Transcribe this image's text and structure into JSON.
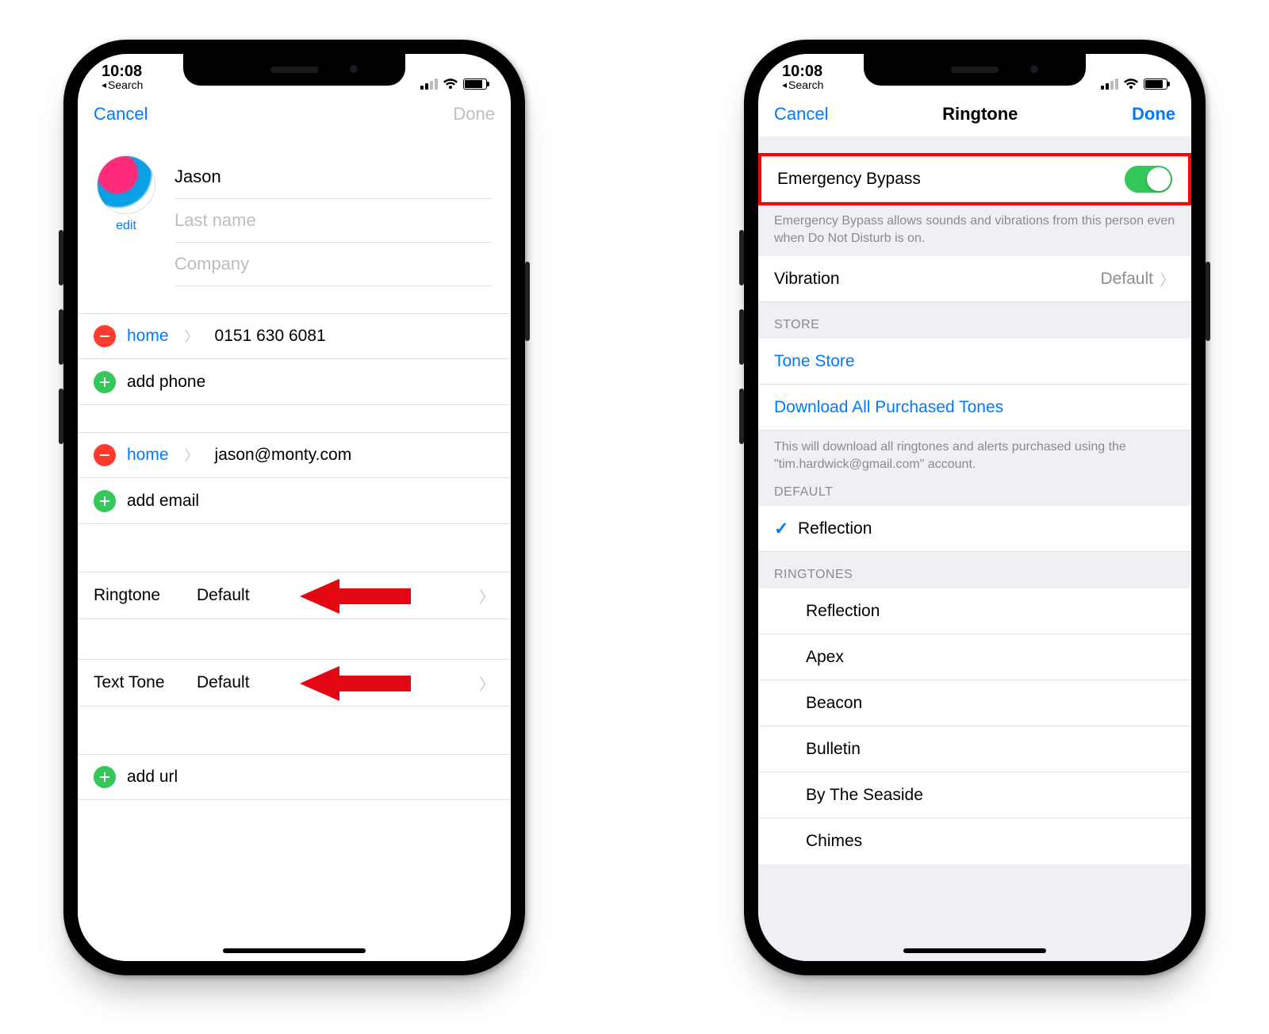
{
  "status": {
    "time": "10:08",
    "back": "Search"
  },
  "left": {
    "nav": {
      "cancel": "Cancel",
      "done": "Done"
    },
    "editLabel": "edit",
    "firstName": "Jason",
    "lastNamePlaceholder": "Last name",
    "companyPlaceholder": "Company",
    "phone": {
      "label": "home",
      "number": "0151 630 6081"
    },
    "addPhone": "add phone",
    "email": {
      "label": "home",
      "address": "jason@monty.com"
    },
    "addEmail": "add email",
    "ringtone": {
      "label": "Ringtone",
      "value": "Default"
    },
    "textTone": {
      "label": "Text Tone",
      "value": "Default"
    },
    "addUrl": "add url"
  },
  "right": {
    "nav": {
      "cancel": "Cancel",
      "title": "Ringtone",
      "done": "Done"
    },
    "emergency": {
      "label": "Emergency Bypass",
      "footer": "Emergency Bypass allows sounds and vibrations from this person even when Do Not Disturb is on."
    },
    "vibration": {
      "label": "Vibration",
      "value": "Default"
    },
    "store": {
      "header": "STORE",
      "toneStore": "Tone Store",
      "downloadAll": "Download All Purchased Tones",
      "footer": "This will download all ringtones and alerts purchased using the \"tim.hardwick@gmail.com\" account."
    },
    "default": {
      "header": "DEFAULT",
      "selected": "Reflection"
    },
    "ringtones": {
      "header": "RINGTONES",
      "items": [
        "Reflection",
        "Apex",
        "Beacon",
        "Bulletin",
        "By The Seaside",
        "Chimes"
      ]
    }
  }
}
